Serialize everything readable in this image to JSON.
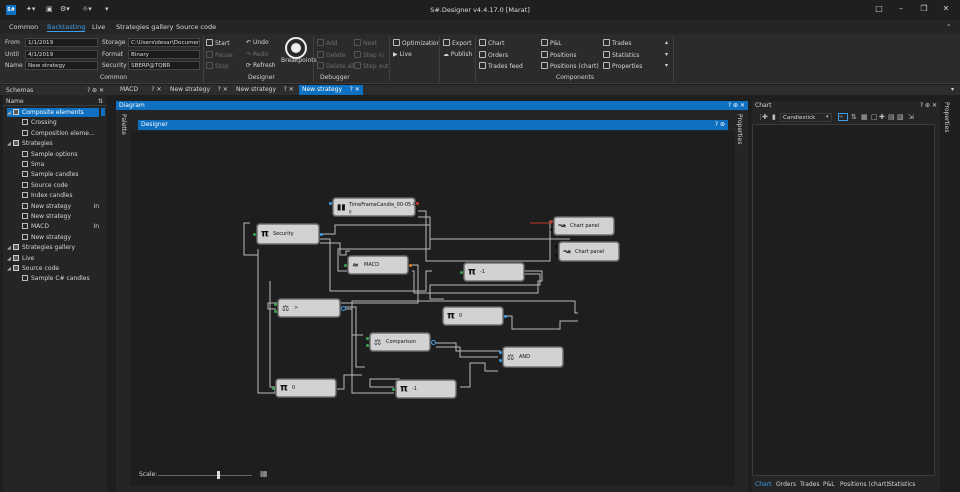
{
  "app": {
    "title": "S#.Designer v4.4.17.0 [Marat]",
    "logo_text": "S#"
  },
  "ribbon_tabs": [
    {
      "label": "Common",
      "active": false
    },
    {
      "label": "Backtesting",
      "active": true
    },
    {
      "label": "Live",
      "active": false
    },
    {
      "label": "Strategies gallery",
      "active": false
    },
    {
      "label": "Source code",
      "active": false
    }
  ],
  "common": {
    "from_label": "From",
    "from_value": "1/1/2019",
    "until_label": "Until",
    "until_value": "4/1/2019",
    "name_label": "Name",
    "name_value": "New strategy",
    "storage_label": "Storage",
    "storage_value": "C:\\Users\\desar\\Documer",
    "format_label": "Format",
    "format_value": "Binary",
    "security_label": "Security",
    "security_value": "SBERP@TQBR",
    "group_label": "Common"
  },
  "designer": {
    "start": "Start",
    "pause": "Pause",
    "stop": "Stop",
    "undo": "Undo",
    "redo": "Redo",
    "refresh": "Refresh",
    "breakpoints": "Breakpoints",
    "group_label": "Designer"
  },
  "debugger": {
    "add": "Add",
    "delete": "Delete",
    "delete_all": "Delete all",
    "next": "Next",
    "step_in": "Step in",
    "step_out": "Step out",
    "group_label": "Debugger"
  },
  "optimization": {
    "optimization": "Optimization",
    "live": "Live",
    "export": "Export",
    "publish": "Publish"
  },
  "components": {
    "chart": "Chart",
    "orders": "Orders",
    "trades_feed": "Trades feed",
    "pnl": "P&L",
    "positions": "Positions",
    "positions_chart": "Positions (chart)",
    "trades": "Trades",
    "statistics": "Statistics",
    "properties": "Properties",
    "group_label": "Components"
  },
  "doc_tabs": [
    {
      "label": "MACD",
      "selected": false
    },
    {
      "label": "New strategy",
      "selected": false
    },
    {
      "label": "New strategy",
      "selected": false
    },
    {
      "label": "New strategy",
      "selected": false
    },
    {
      "label": "New strategy",
      "selected": true
    }
  ],
  "schemas": {
    "title": "Schemas",
    "column_name": "Name",
    "items": [
      {
        "label": "Composite elements",
        "level": 0,
        "type": "folder",
        "selected": true
      },
      {
        "label": "Crossing",
        "level": 1,
        "type": "file"
      },
      {
        "label": "Composition eleme...",
        "level": 1,
        "type": "file"
      },
      {
        "label": "Strategies",
        "level": 0,
        "type": "folder"
      },
      {
        "label": "Sample options",
        "level": 1,
        "type": "file"
      },
      {
        "label": "Sma",
        "level": 1,
        "type": "file"
      },
      {
        "label": "Sample candles",
        "level": 1,
        "type": "file"
      },
      {
        "label": "Source code",
        "level": 1,
        "type": "file"
      },
      {
        "label": "Index candles",
        "level": 1,
        "type": "file"
      },
      {
        "label": "New strategy",
        "level": 1,
        "type": "file",
        "badge": "In"
      },
      {
        "label": "New strategy",
        "level": 1,
        "type": "file"
      },
      {
        "label": "MACD",
        "level": 1,
        "type": "file",
        "badge": "In"
      },
      {
        "label": "New strategy",
        "level": 1,
        "type": "file"
      },
      {
        "label": "Strategies gallery",
        "level": 0,
        "type": "folder"
      },
      {
        "label": "Live",
        "level": 0,
        "type": "folder"
      },
      {
        "label": "Source code",
        "level": 0,
        "type": "folder"
      },
      {
        "label": "Sample C# candles",
        "level": 1,
        "type": "cs"
      }
    ]
  },
  "diagram": {
    "title": "Diagram",
    "palette": "Palette",
    "properties": "Properties",
    "designer_title": "Designer",
    "scale_label": "Scale:"
  },
  "nodes": [
    {
      "id": "candles",
      "label": "TimeFrameCandle_00-05-0",
      "sub": "0",
      "icon": "candles-icon"
    },
    {
      "id": "security",
      "label": "Security",
      "icon": "pi-icon"
    },
    {
      "id": "chart1",
      "label": "Chart panel",
      "icon": "chart-icon"
    },
    {
      "id": "chart2",
      "label": "Chart panel",
      "icon": "chart-icon"
    },
    {
      "id": "macd",
      "label": "MACD",
      "icon": "indicator-icon"
    },
    {
      "id": "pi1",
      "label": "-1",
      "icon": "pi-icon"
    },
    {
      "id": "gt",
      "label": ">",
      "icon": "compare-icon"
    },
    {
      "id": "pi0a",
      "label": "0",
      "icon": "pi-icon"
    },
    {
      "id": "comparison",
      "label": "Comparison",
      "icon": "compare-icon"
    },
    {
      "id": "and",
      "label": "AND",
      "icon": "compare-icon"
    },
    {
      "id": "pi0b",
      "label": "0",
      "icon": "pi-icon"
    },
    {
      "id": "pi1b",
      "label": "-1",
      "icon": "pi-icon"
    }
  ],
  "chart": {
    "title": "Chart",
    "style_value": "Candlestick",
    "properties": "Properties"
  },
  "chart_tabs": [
    {
      "label": "Chart",
      "active": true
    },
    {
      "label": "Orders",
      "active": false
    },
    {
      "label": "Trades",
      "active": false
    },
    {
      "label": "P&L",
      "active": false
    },
    {
      "label": "Positions (chart)",
      "active": false
    },
    {
      "label": "Statistics",
      "active": false
    }
  ],
  "colors": {
    "accent": "#0e70c0",
    "tab_accent": "#3d9ee9",
    "node_bg": "#d2d2d2",
    "wire": "#b9b9b9"
  }
}
